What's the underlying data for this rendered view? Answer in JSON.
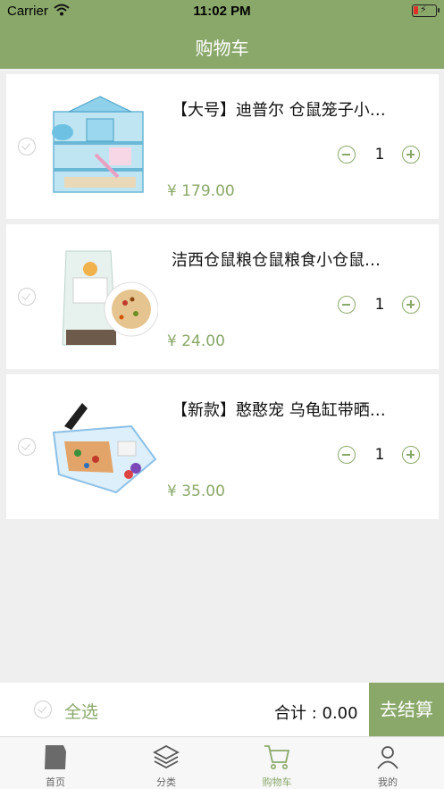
{
  "status_bar": {
    "carrier": "Carrier",
    "time": "11:02 PM"
  },
  "nav": {
    "title": "购物车"
  },
  "cart": {
    "items": [
      {
        "name": "【大号】迪普尔 仓鼠笼子小…",
        "price": "¥ 179.00",
        "quantity": "1",
        "image": "hamster-cage-image"
      },
      {
        "name": "洁西仓鼠粮仓鼠粮食小仓鼠…",
        "price": "¥ 24.00",
        "quantity": "1",
        "image": "hamster-food-image"
      },
      {
        "name": "【新款】憨憨宠 乌龟缸带晒…",
        "price": "¥ 35.00",
        "quantity": "1",
        "image": "turtle-tank-image"
      }
    ]
  },
  "checkout": {
    "select_all_label": "全选",
    "total_label": "合计 : 0.00",
    "button_label": "去结算"
  },
  "tabs": [
    {
      "label": "首页",
      "icon": "home-icon"
    },
    {
      "label": "分类",
      "icon": "layers-icon"
    },
    {
      "label": "购物车",
      "icon": "cart-icon",
      "active": true
    },
    {
      "label": "我的",
      "icon": "profile-icon"
    }
  ],
  "colors": {
    "accent": "#8aa86a",
    "background": "#efefef"
  }
}
